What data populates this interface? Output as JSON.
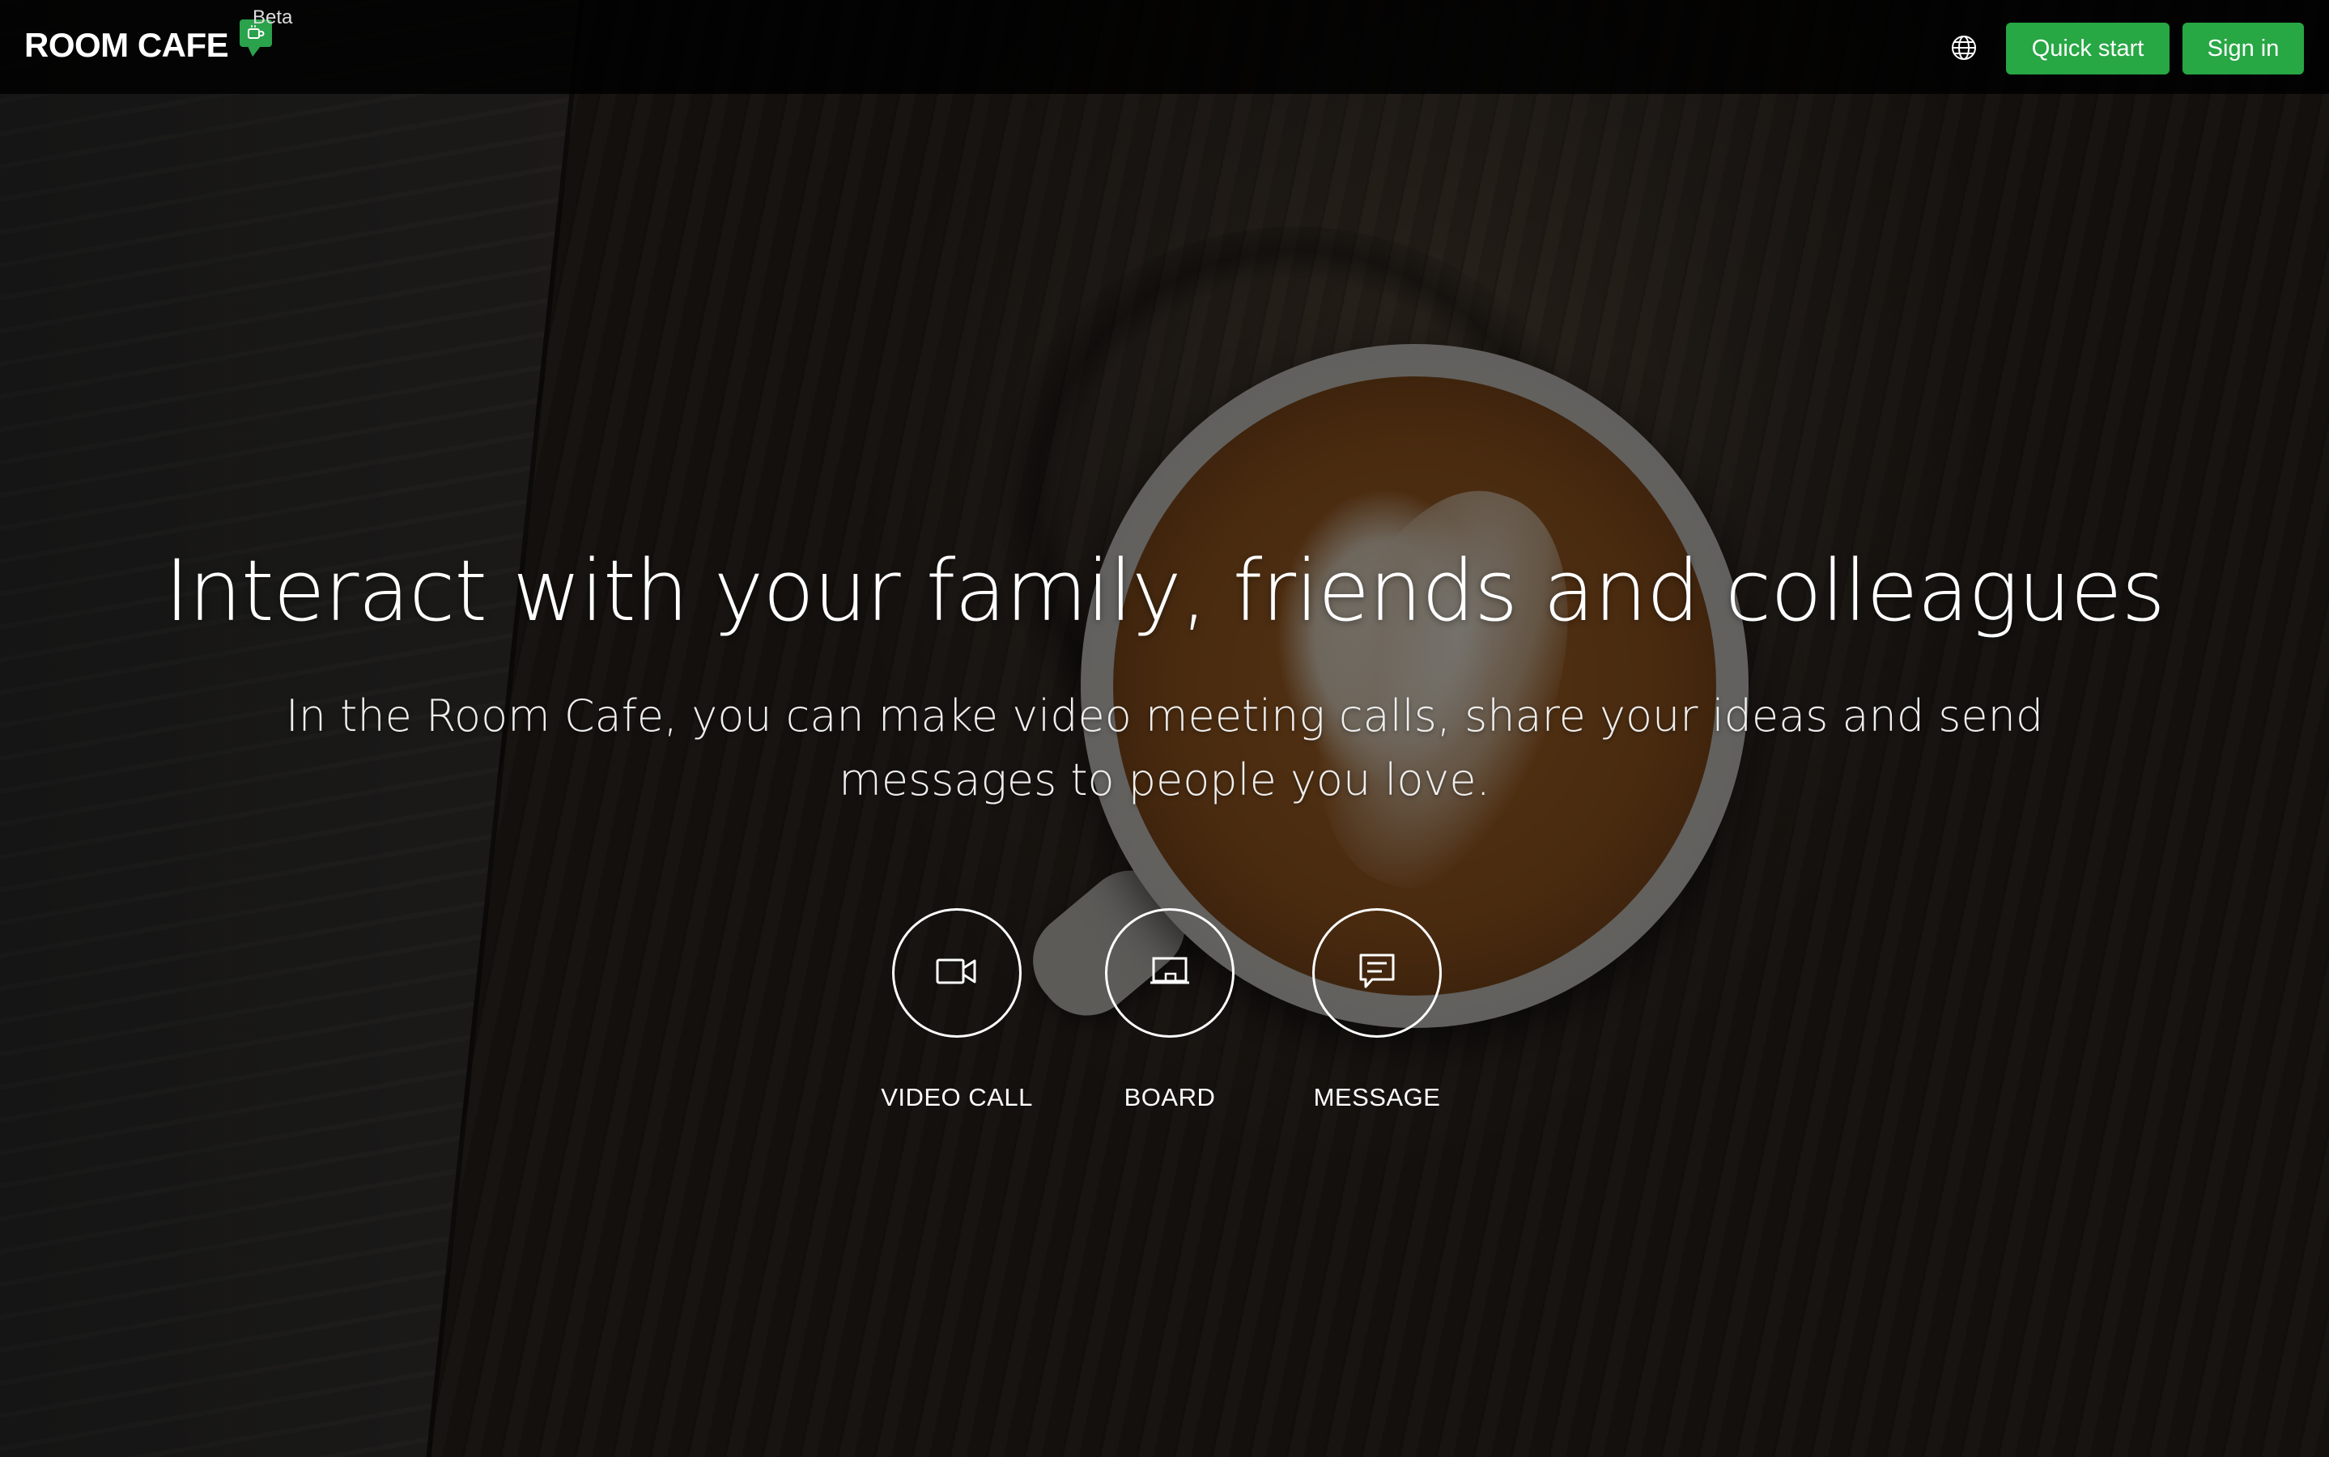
{
  "header": {
    "brand": "ROOM CAFE",
    "badge": "Beta",
    "language_icon": "globe-icon",
    "quick_start_label": "Quick start",
    "sign_in_label": "Sign in"
  },
  "hero": {
    "title": "Interact with your family, friends and colleagues",
    "subtitle": "In the Room Cafe, you can make video meeting calls, share your ideas and send messages to people you love."
  },
  "features": [
    {
      "label": "VIDEO CALL",
      "icon": "video-camera-icon"
    },
    {
      "label": "BOARD",
      "icon": "board-icon"
    },
    {
      "label": "MESSAGE",
      "icon": "chat-message-icon"
    }
  ],
  "colors": {
    "accent": "#28a745",
    "header_bg": "#000000",
    "text": "#ffffff"
  }
}
